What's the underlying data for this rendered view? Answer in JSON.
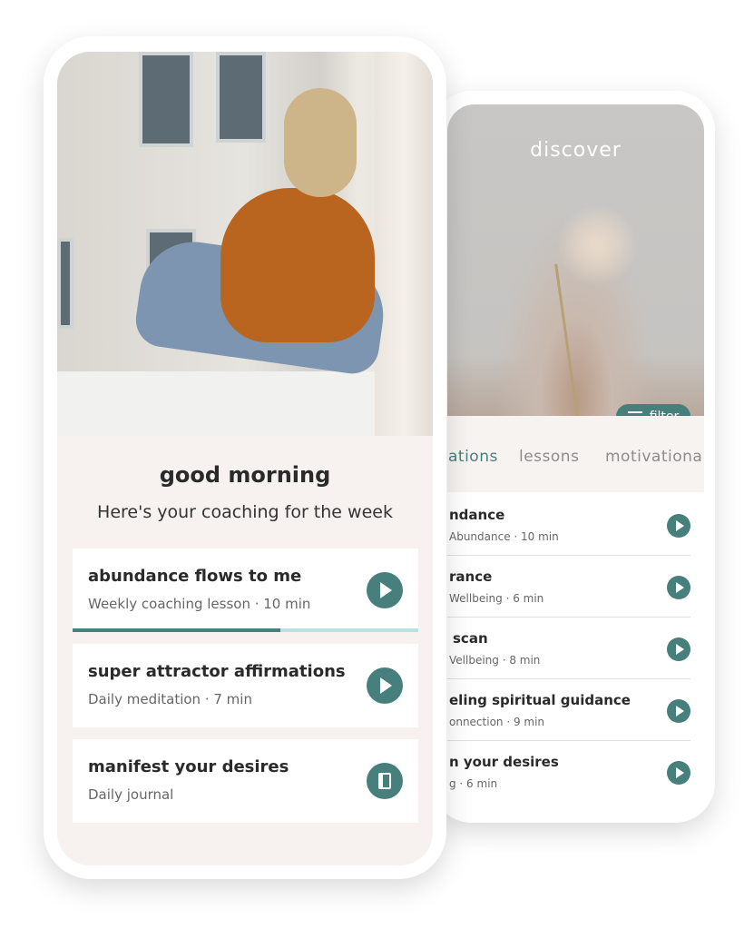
{
  "colors": {
    "accent": "#467f7b",
    "progress_track": "#b9e1e0",
    "background": "#f7f2ef"
  },
  "discover": {
    "title": "discover",
    "filter_label": "filter",
    "filter_icon": "filter-lines-icon",
    "tabs": [
      {
        "label": "ations",
        "active": true
      },
      {
        "label": "lessons",
        "active": false
      },
      {
        "label": "motivationa",
        "active": false
      }
    ],
    "items": [
      {
        "title": "ndance",
        "subtitle": "Abundance · 10 min",
        "icon": "play-icon"
      },
      {
        "title": "rance",
        "subtitle": "Wellbeing · 6 min",
        "icon": "play-icon"
      },
      {
        "title": "scan",
        "subtitle": "Vellbeing · 8 min",
        "icon": "play-icon"
      },
      {
        "title": "eling spiritual guidance",
        "subtitle": "onnection · 9 min",
        "icon": "play-icon"
      },
      {
        "title": "n your desires",
        "subtitle": "g · 6 min",
        "icon": "play-icon"
      }
    ]
  },
  "home": {
    "greeting": "good morning",
    "subtitle": "Here's your coaching for the week",
    "cards": [
      {
        "title": "abundance flows to me",
        "subtitle": "Weekly coaching lesson · 10 min",
        "icon": "play-icon",
        "progress": 0.6
      },
      {
        "title": "super attractor affirmations",
        "subtitle": "Daily meditation · 7 min",
        "icon": "play-icon"
      },
      {
        "title": "manifest your desires",
        "subtitle": "Daily journal",
        "icon": "journal-icon"
      }
    ]
  }
}
